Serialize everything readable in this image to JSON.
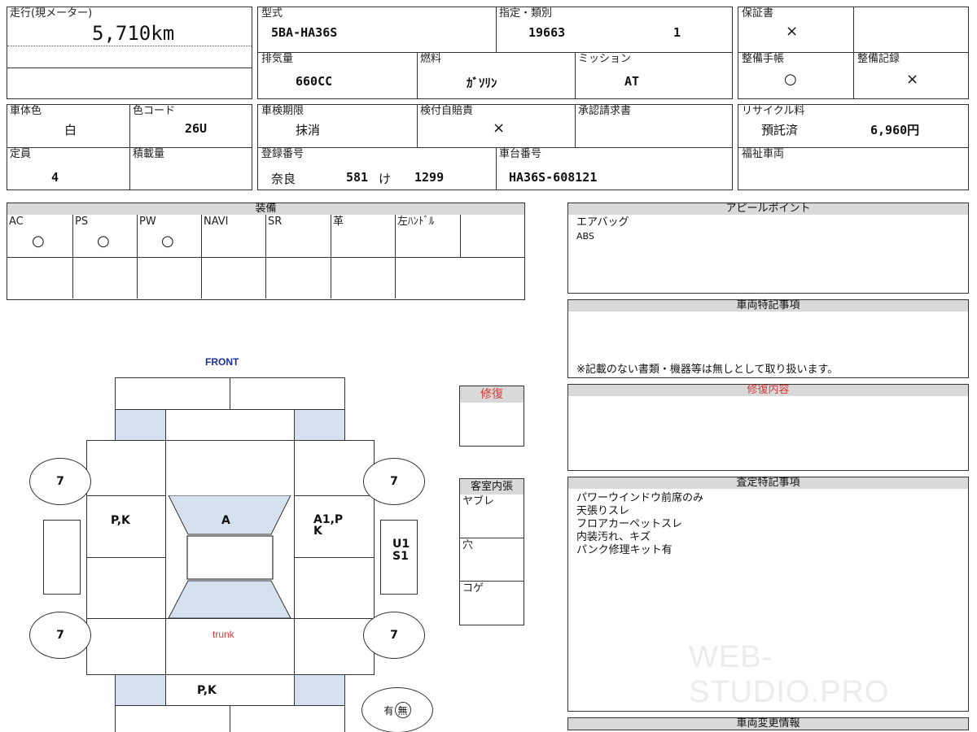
{
  "mileage": {
    "label": "走行(現メーター)",
    "value": "5,710km"
  },
  "model": {
    "label": "型式",
    "value": "5BA-HA36S"
  },
  "designation": {
    "label": "指定・類別",
    "value1": "19663",
    "value2": "1"
  },
  "warranty": {
    "label": "保証書",
    "value": "×"
  },
  "displacement": {
    "label": "排気量",
    "value": "660CC"
  },
  "fuel": {
    "label": "燃料",
    "value": "ｶﾞｿﾘﾝ"
  },
  "transmission": {
    "label": "ミッション",
    "value": "AT"
  },
  "maint_book": {
    "label": "整備手帳",
    "value": "○"
  },
  "maint_record": {
    "label": "整備記録",
    "value": "×"
  },
  "body_color": {
    "label": "車体色",
    "value": "白"
  },
  "color_code": {
    "label": "色コード",
    "value": "26U"
  },
  "inspection": {
    "label": "車検期限",
    "value": "抹消"
  },
  "insurance": {
    "label": "検付自賠責",
    "value": "×"
  },
  "approval": {
    "label": "承認請求書",
    "value": ""
  },
  "recycle": {
    "label": "リサイクル料",
    "status": "預託済",
    "amount": "6,960円"
  },
  "capacity": {
    "label": "定員",
    "value": "4"
  },
  "load": {
    "label": "積載量",
    "value": ""
  },
  "registration": {
    "label": "登録番号",
    "area": "奈良",
    "class": "581",
    "kana": "け",
    "number": "1299"
  },
  "chassis": {
    "label": "車台番号",
    "value": "HA36S-608121"
  },
  "welfare": {
    "label": "福祉車両"
  },
  "equipment": {
    "title": "装備",
    "items": [
      {
        "label": "AC",
        "mark": "○"
      },
      {
        "label": "PS",
        "mark": "○"
      },
      {
        "label": "PW",
        "mark": "○"
      },
      {
        "label": "NAVI",
        "mark": ""
      },
      {
        "label": "SR",
        "mark": ""
      },
      {
        "label": "革",
        "mark": ""
      },
      {
        "label": "左ﾊﾝﾄﾞﾙ",
        "mark": ""
      }
    ]
  },
  "appeal": {
    "title": "アピールポイント",
    "lines": [
      "エアバッグ",
      "ABS"
    ]
  },
  "vehicle_notes": {
    "title": "車両特記事項",
    "note": "※記載のない書類・機器等は無しとして取り扱います。"
  },
  "repair_details": {
    "title": "修復内容"
  },
  "assessment": {
    "title": "査定特記事項",
    "lines": [
      "パワーウインドウ前席のみ",
      "天張りスレ",
      "フロアカーペットスレ",
      "内装汚れ、キズ",
      "パンク修理キット有"
    ]
  },
  "change_info": {
    "title": "車両変更情報"
  },
  "repair": {
    "label": "修復"
  },
  "interior": {
    "title": "客室内張",
    "rows": [
      "ヤブレ",
      "穴",
      "コゲ"
    ]
  },
  "diagram": {
    "front": "FRONT",
    "trunk": "trunk",
    "tires": [
      "7",
      "7",
      "7",
      "7"
    ],
    "codes": {
      "left_door": "P,K",
      "roof_front": "A",
      "right_door": "A1,P K",
      "right_glass_1": "U1",
      "right_glass_2": "S1",
      "rear": "P,K"
    },
    "presence": {
      "yes": "有",
      "no": "無"
    }
  },
  "watermark": "WEB-STUDIO.PRO"
}
